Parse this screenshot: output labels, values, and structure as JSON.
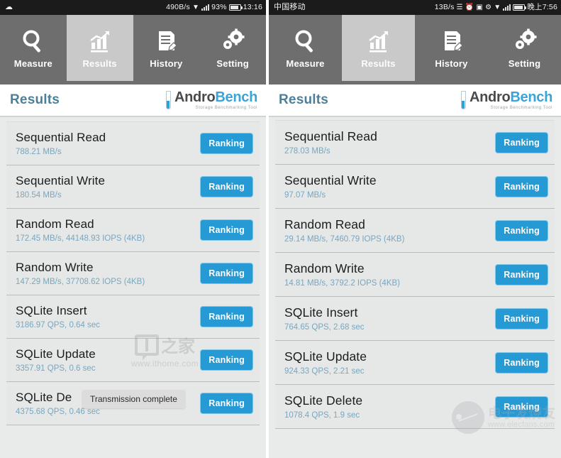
{
  "left": {
    "status_bar": {
      "left_icon": "cloud-icon",
      "net_speed": "490B/s",
      "wifi_icon": "wifi-icon",
      "signal_icon": "signal-icon",
      "battery_percent": "93%",
      "battery_icon": "battery-icon",
      "clock": "13:16"
    },
    "tabs": [
      {
        "label": "Measure",
        "icon": "magnifier-icon",
        "active": false
      },
      {
        "label": "Results",
        "icon": "bar-chart-icon",
        "active": true
      },
      {
        "label": "History",
        "icon": "document-pen-icon",
        "active": false
      },
      {
        "label": "Setting",
        "icon": "gears-icon",
        "active": false
      }
    ],
    "header": {
      "title": "Results",
      "logo_icon": "test-tube-icon",
      "logo_primary": "Andro",
      "logo_accent": "Bench",
      "logo_subtitle": "Storage Benchmarking Tool"
    },
    "rows": [
      {
        "title": "Sequential Read",
        "value": "788.21 MB/s",
        "button": "Ranking"
      },
      {
        "title": "Sequential Write",
        "value": "180.54 MB/s",
        "button": "Ranking"
      },
      {
        "title": "Random Read",
        "value": "172.45 MB/s, 44148.93 IOPS (4KB)",
        "button": "Ranking"
      },
      {
        "title": "Random Write",
        "value": "147.29 MB/s, 37708.62 IOPS (4KB)",
        "button": "Ranking"
      },
      {
        "title": "SQLite Insert",
        "value": "3186.97 QPS, 0.64 sec",
        "button": "Ranking"
      },
      {
        "title": "SQLite Update",
        "value": "3357.91 QPS, 0.6 sec",
        "button": "Ranking"
      },
      {
        "title": "SQLite De",
        "value": "4375.68 QPS, 0.46 sec",
        "button": "Ranking"
      }
    ],
    "toast": "Transmission complete"
  },
  "right": {
    "status_bar": {
      "carrier": "中国移动",
      "net_speed": "13B/s",
      "vibrate_icon": "vibrate-icon",
      "alarm_icon": "alarm-icon",
      "screenshot_icon": "screenshot-icon",
      "bluetooth_icon": "bluetooth-icon",
      "wifi_icon": "wifi-icon",
      "signal_icon": "signal-icon",
      "battery_icon": "battery-icon",
      "clock": "晚上7:56"
    },
    "tabs": [
      {
        "label": "Measure",
        "icon": "magnifier-icon",
        "active": false
      },
      {
        "label": "Results",
        "icon": "bar-chart-icon",
        "active": true
      },
      {
        "label": "History",
        "icon": "document-pen-icon",
        "active": false
      },
      {
        "label": "Setting",
        "icon": "gears-icon",
        "active": false
      }
    ],
    "header": {
      "title": "Results",
      "logo_icon": "test-tube-icon",
      "logo_primary": "Andro",
      "logo_accent": "Bench",
      "logo_subtitle": "Storage Benchmarking Tool"
    },
    "rows": [
      {
        "title": "Sequential Read",
        "value": "278.03 MB/s",
        "button": "Ranking"
      },
      {
        "title": "Sequential Write",
        "value": "97.07 MB/s",
        "button": "Ranking"
      },
      {
        "title": "Random Read",
        "value": "29.14 MB/s, 7460.79 IOPS (4KB)",
        "button": "Ranking"
      },
      {
        "title": "Random Write",
        "value": "14.81 MB/s, 3792.2 IOPS (4KB)",
        "button": "Ranking"
      },
      {
        "title": "SQLite Insert",
        "value": "764.65 QPS, 2.68 sec",
        "button": "Ranking"
      },
      {
        "title": "SQLite Update",
        "value": "924.33 QPS, 2.21 sec",
        "button": "Ranking"
      },
      {
        "title": "SQLite Delete",
        "value": "1078.4 QPS, 1.9 sec",
        "button": "Ranking"
      }
    ]
  },
  "watermarks": {
    "ithome_cn": "之家",
    "ithome_url": "www.ithome.com",
    "elecfans_cn": "电子发烧友",
    "elecfans_url": "www.elecfans.com"
  },
  "colors": {
    "accent_blue": "#259ad5",
    "title_teal": "#4d7f96",
    "value_blue": "#79a7bf",
    "tabbar_gray": "#6e6e6e",
    "tab_active_gray": "#c9c9c9",
    "card_gray": "#e6e7e7"
  }
}
